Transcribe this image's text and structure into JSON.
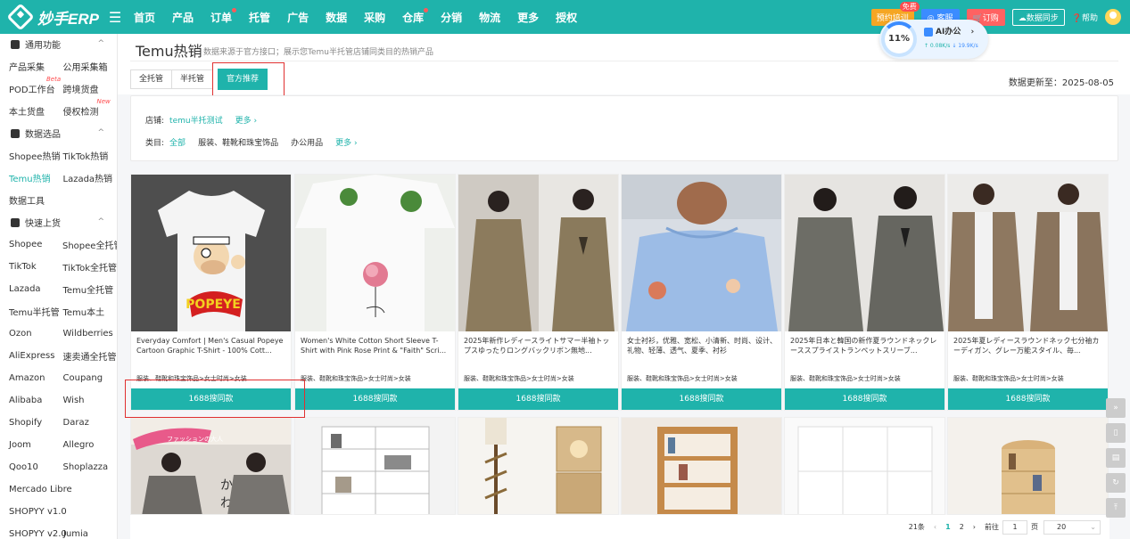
{
  "app": {
    "logo": "妙手ERP",
    "menu_icon": "menu-icon"
  },
  "nav": [
    "首页",
    "产品",
    "订单",
    "托管",
    "广告",
    "数据",
    "采购",
    "仓库",
    "分销",
    "物流",
    "更多",
    "授权"
  ],
  "nav_dots": [
    2,
    7
  ],
  "topright": {
    "train": "预约培训",
    "free": "免费",
    "cs": "客服",
    "order": "订购",
    "sync": "数据同步",
    "help": "帮助"
  },
  "widget": {
    "percent": "11%",
    "ai": "AI办公",
    "up": "↑ 0.08K/s",
    "down": "↓ 19.9K/s"
  },
  "sidebar": {
    "sec1": "通用功能",
    "rows1": [
      [
        "产品采集",
        "公用采集箱"
      ],
      [
        "POD工作台",
        "跨境货盘"
      ],
      [
        "本土货盘",
        "侵权检测"
      ]
    ],
    "beta": "Beta",
    "new": "New",
    "sec2": "数据选品",
    "rows2": [
      [
        "Shopee热销",
        "TikTok热销"
      ],
      [
        "Temu热销",
        "Lazada热销"
      ],
      [
        "数据工具",
        ""
      ]
    ],
    "sec3": "快速上货",
    "rows3": [
      [
        "Shopee",
        "Shopee全托管"
      ],
      [
        "TikTok",
        "TikTok全托管"
      ],
      [
        "Lazada",
        "Temu全托管"
      ],
      [
        "Temu半托管",
        "Temu本土"
      ],
      [
        "Ozon",
        "Wildberries"
      ],
      [
        "AliExpress",
        "速卖通全托管"
      ],
      [
        "Amazon",
        "Coupang"
      ],
      [
        "Alibaba",
        "Wish"
      ],
      [
        "Shopify",
        "Daraz"
      ],
      [
        "Joom",
        "Allegro"
      ],
      [
        "Qoo10",
        "Shoplazza"
      ],
      [
        "Mercado Libre",
        ""
      ],
      [
        "SHOPYY v1.0",
        ""
      ],
      [
        "SHOPYY v2.0",
        "Jumia"
      ]
    ]
  },
  "page": {
    "title": "Temu热销",
    "subtitle": "数据来源于官方接口；展示您Temu半托管店铺同类目的热销产品",
    "update": "数据更新至：2025-08-05"
  },
  "tabs": [
    "全托管",
    "半托管",
    "官方推荐"
  ],
  "filters": {
    "store_label": "店铺:",
    "store_val": "temu半托测试",
    "more": "更多 ›",
    "cat_label": "类目:",
    "cats": [
      "全部",
      "服装、鞋靴和珠宝饰品",
      "办公用品"
    ]
  },
  "products": [
    {
      "title": "Everyday Comfort | Men's Casual Popeye Cartoon Graphic T-Shirt - 100% Cott...",
      "cat": "服装、鞋靴和珠宝饰品>女士时尚>女装",
      "btn": "1688搜同款",
      "img_text": "POPEYE"
    },
    {
      "title": "Women's White Cotton Short Sleeve T-Shirt with Pink Rose Print & \"Faith\" Scri...",
      "cat": "服装、鞋靴和珠宝饰品>女士时尚>女装",
      "btn": "1688搜同款"
    },
    {
      "title": "2025年新作レディースライトサマー半袖トップスゆったりロングバックリボン無地...",
      "cat": "服装、鞋靴和珠宝饰品>女士时尚>女装",
      "btn": "1688搜同款"
    },
    {
      "title": "女士衬衫，优雅、宽松、小清新、时尚、设计、礼物、轻薄、透气、夏季、衬衫",
      "cat": "服装、鞋靴和珠宝饰品>女士时尚>女装",
      "btn": "1688搜同款"
    },
    {
      "title": "2025年日本と韓国の新作夏ラウンドネックレーススプライストランペットスリーブ...",
      "cat": "服装、鞋靴和珠宝饰品>女士时尚>女装",
      "btn": "1688搜同款"
    },
    {
      "title": "2025年夏レディースラウンドネック七分袖カーディガン、グレー万能スタイル、毎...",
      "cat": "服装、鞋靴和珠宝饰品>女士时尚>女装",
      "btn": "1688搜同款"
    }
  ],
  "row2_img_text": [
    "ファッションの大人",
    "かわい"
  ],
  "pager": {
    "total": "21条",
    "prev": "‹",
    "p1": "1",
    "p2": "2",
    "next": "›",
    "goto": "前往",
    "page_no": "1",
    "page": "页",
    "size": "20"
  }
}
